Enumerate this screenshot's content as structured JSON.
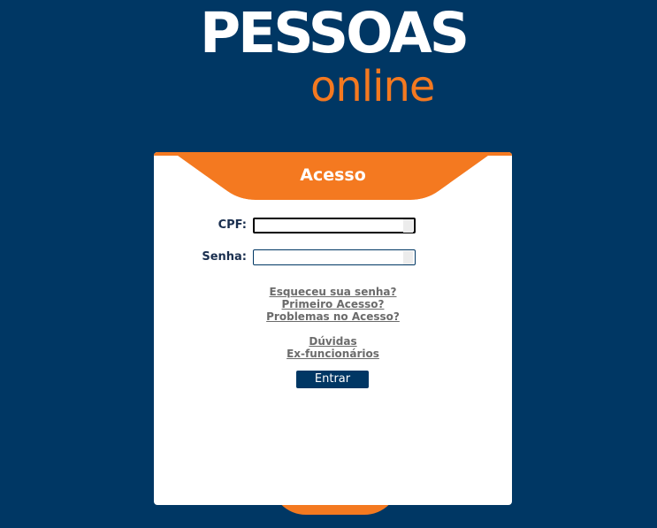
{
  "logo": {
    "main_text": "PESSOAS",
    "sub_text": "online"
  },
  "colors": {
    "background": "#003764",
    "accent": "#f47920",
    "accent_light": "#fbb98c",
    "link": "#6b6b6b"
  },
  "card": {
    "title": "Acesso"
  },
  "form": {
    "cpf": {
      "label": "CPF:",
      "value": ""
    },
    "senha": {
      "label": "Senha:",
      "value": ""
    }
  },
  "links": {
    "forgot_password": "Esqueceu sua senha?",
    "first_access": "Primeiro Acesso?",
    "access_problems": "Problemas no Acesso?",
    "questions": "Dúvidas",
    "former_employees": "Ex-funcionários"
  },
  "buttons": {
    "enter": "Entrar"
  }
}
